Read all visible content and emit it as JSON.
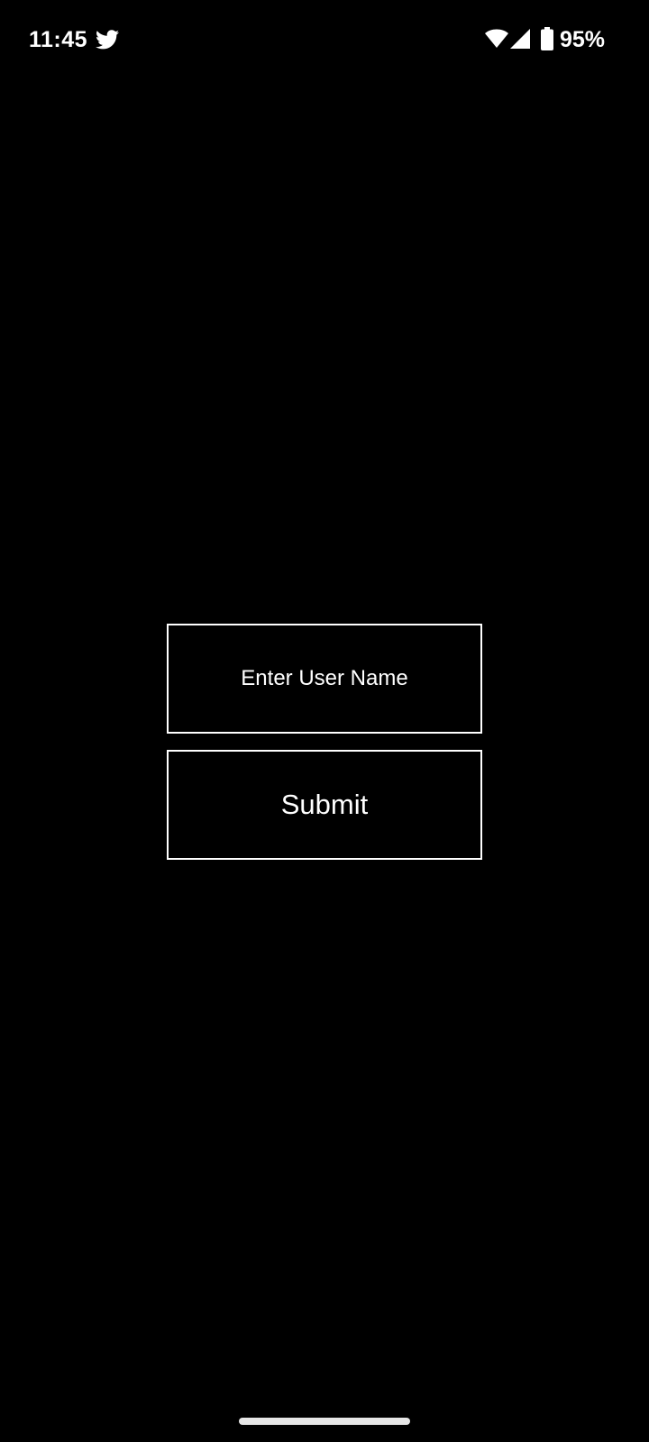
{
  "status_bar": {
    "time": "11:45",
    "notification_icon": "twitter-icon",
    "wifi_icon": "wifi-icon",
    "signal_icon": "signal-icon",
    "battery_icon": "battery-icon",
    "battery_percent": "95%"
  },
  "form": {
    "username_placeholder": "Enter User Name",
    "username_value": "",
    "submit_label": "Submit"
  },
  "colors": {
    "background": "#000000",
    "foreground": "#ffffff"
  }
}
